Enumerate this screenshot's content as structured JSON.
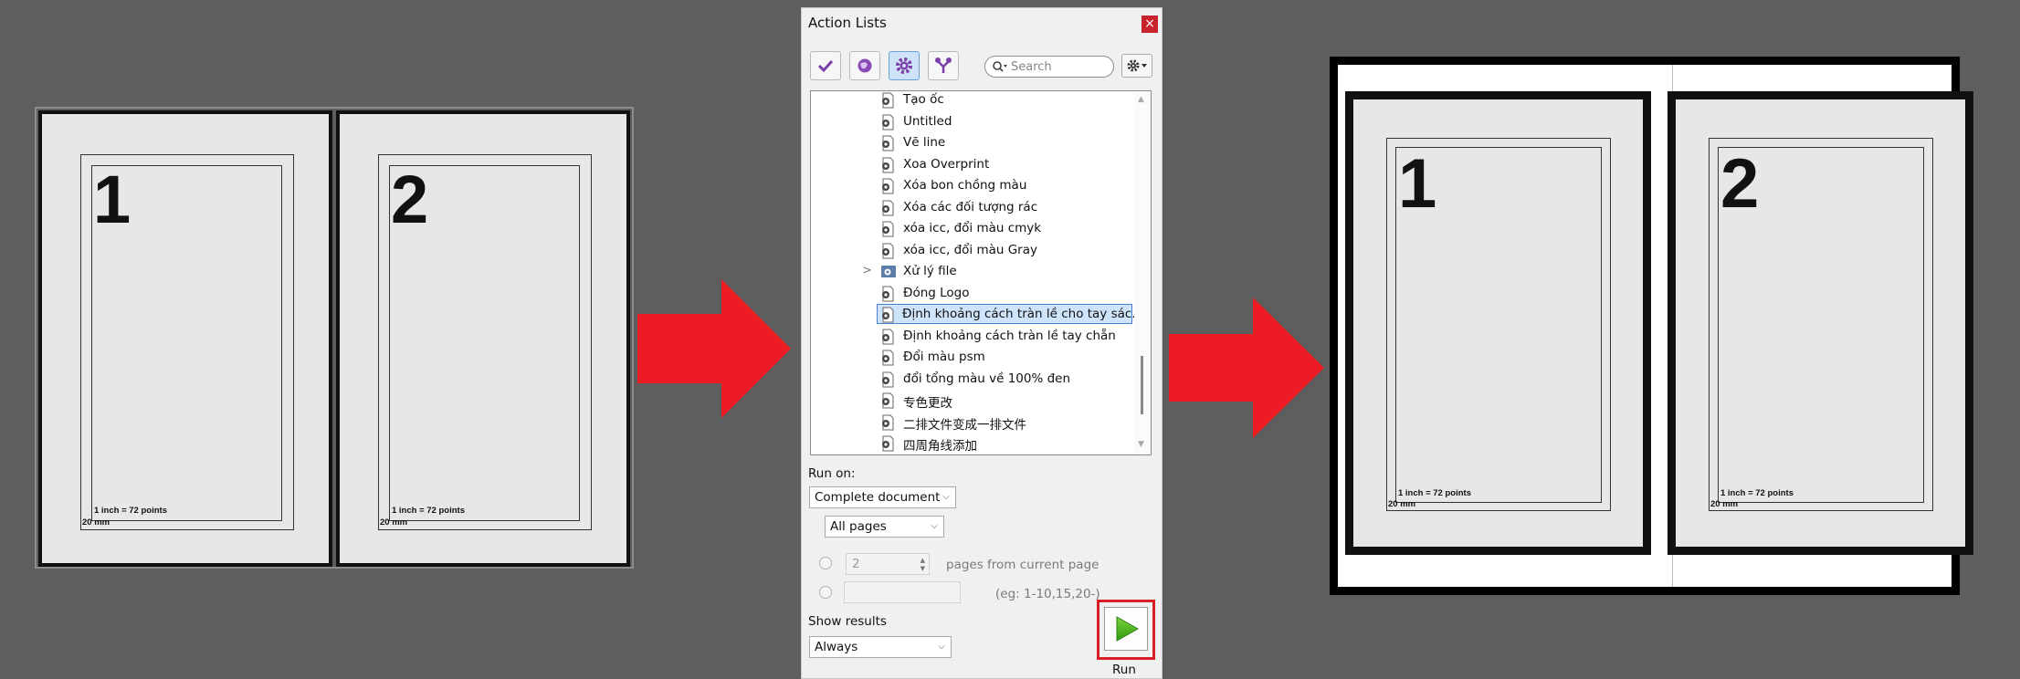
{
  "left_preview": {
    "pages": [
      {
        "number": "1",
        "note": "1 inch = 72 points",
        "margin": "20 mm"
      },
      {
        "number": "2",
        "note": "1 inch = 72 points",
        "margin": "20 mm"
      }
    ]
  },
  "right_preview": {
    "pages": [
      {
        "number": "1",
        "note": "1 inch = 72 points",
        "margin": "20 mm"
      },
      {
        "number": "2",
        "note": "1 inch = 72 points",
        "margin": "20 mm"
      }
    ]
  },
  "colors": {
    "arrow": "#ed1c24",
    "background": "#5e5e5e",
    "selection": "#cde4fb",
    "run_highlight": "#d81f26"
  },
  "dialog": {
    "title": "Action Lists",
    "close_label": "×",
    "toolbar": {
      "buttons": [
        {
          "name": "check-icon"
        },
        {
          "name": "globe-icon"
        },
        {
          "name": "gear-icon",
          "active": true
        },
        {
          "name": "filter-icon"
        }
      ],
      "search_placeholder": "Search",
      "options_icon": "gear-icon"
    },
    "list": {
      "items": [
        {
          "label": "Tạo ốc"
        },
        {
          "label": "Untitled"
        },
        {
          "label": "Vẽ line"
        },
        {
          "label": "Xoa Overprint"
        },
        {
          "label": "Xóa bon chồng màu"
        },
        {
          "label": "Xóa các đối tượng rác"
        },
        {
          "label": "xóa icc, đổi màu cmyk"
        },
        {
          "label": "xóa icc, đổi màu Gray"
        },
        {
          "label": "Xử lý file",
          "folder": true
        },
        {
          "label": "Đóng Logo"
        },
        {
          "label": "Định khoảng cách tràn lề cho tay sác...",
          "selected": true
        },
        {
          "label": "Định khoảng cách tràn lề tay chẵn"
        },
        {
          "label": "Đổi màu psm"
        },
        {
          "label": "đổi tổng màu về 100% đen"
        },
        {
          "label": "专色更改"
        },
        {
          "label": "二排文件变成一排文件"
        },
        {
          "label": "四周角线添加"
        }
      ]
    },
    "run_on": {
      "label": "Run on:",
      "scope_value": "Complete document",
      "pages_value": "All pages",
      "pages_count_value": "2",
      "pages_from_label": "pages from current page",
      "range_hint": "(eg: 1-10,15,20-)"
    },
    "show_results": {
      "label": "Show results",
      "value": "Always"
    },
    "run_label": "Run"
  }
}
